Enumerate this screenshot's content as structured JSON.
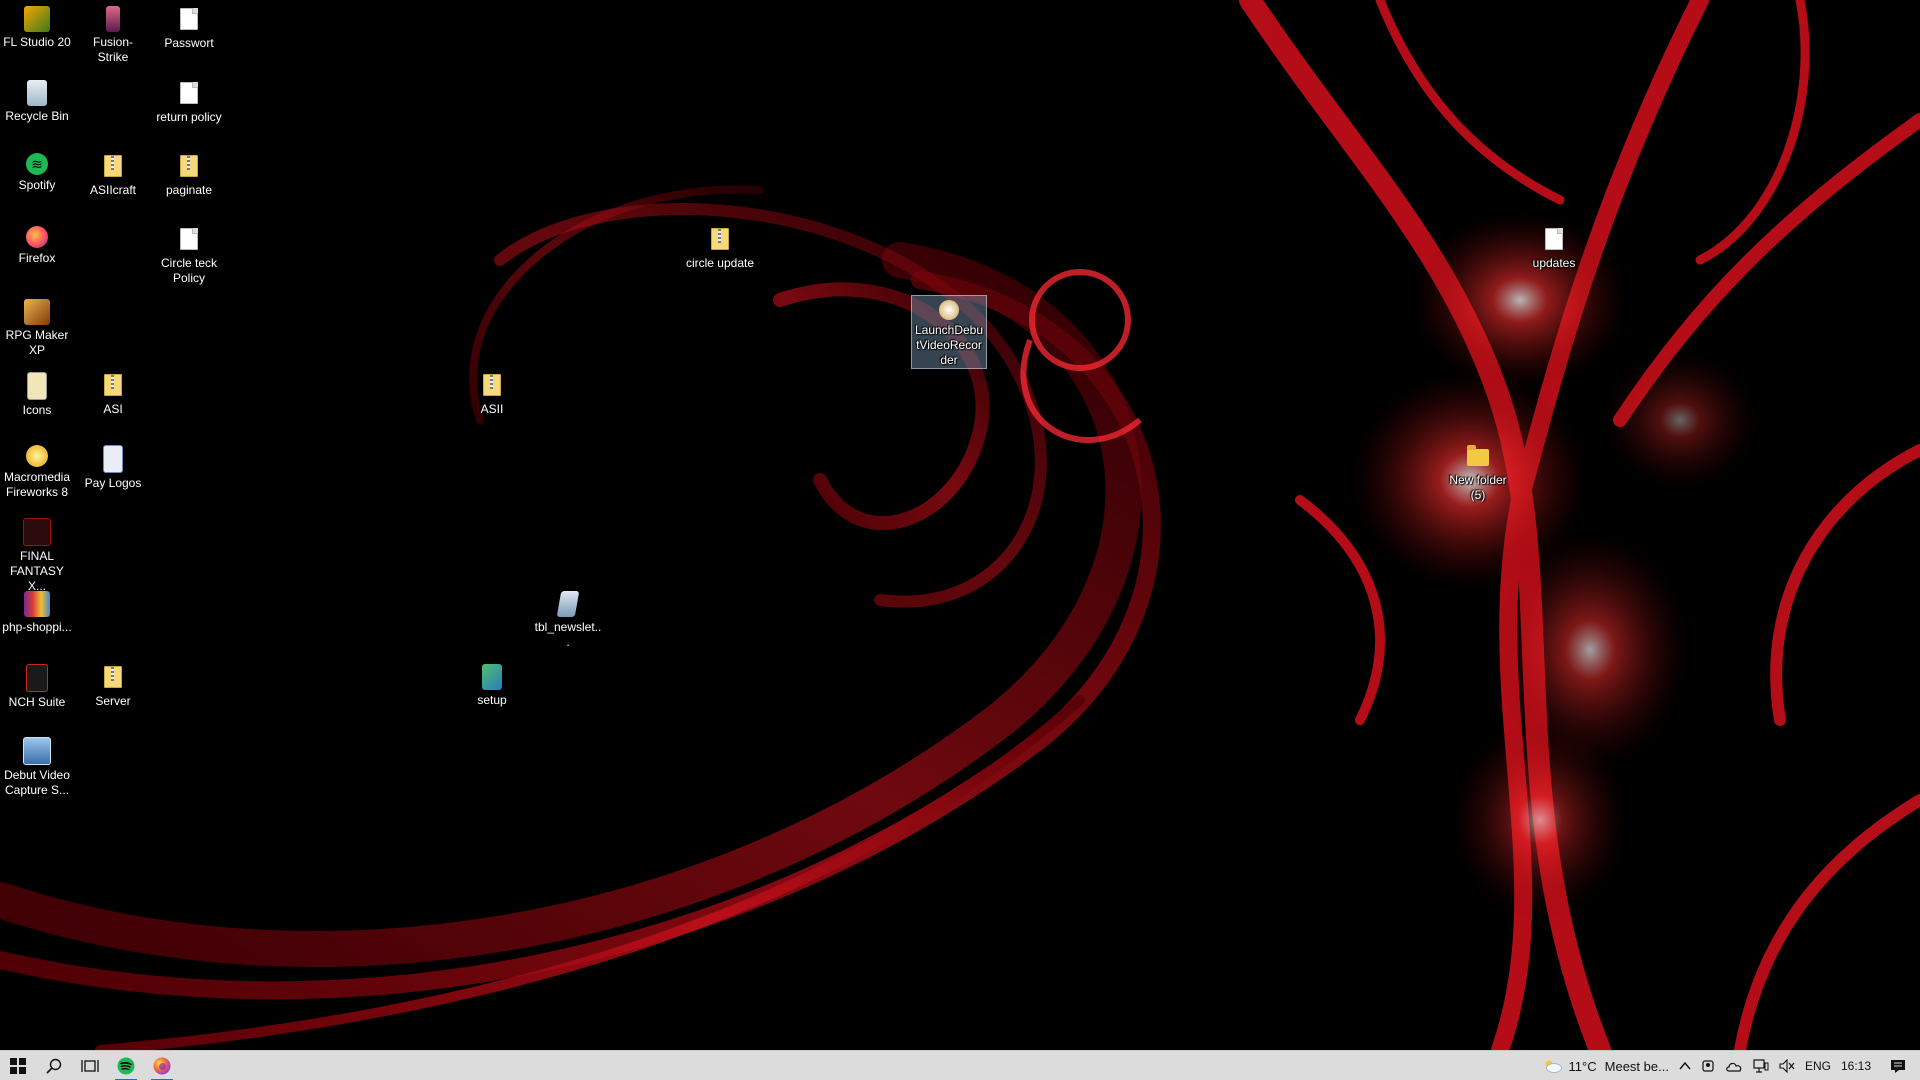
{
  "desktop": {
    "icons": [
      {
        "label": "FL Studio 20",
        "icon": "fl-studio-icon"
      },
      {
        "label": "Fusion-Strike",
        "icon": "fusion-strike-icon"
      },
      {
        "label": "Passwort",
        "icon": "document-icon"
      },
      {
        "label": "Recycle Bin",
        "icon": "recycle-bin-icon"
      },
      {
        "label": "return policy",
        "icon": "document-icon"
      },
      {
        "label": "Spotify",
        "icon": "spotify-icon"
      },
      {
        "label": "ASIIcraft",
        "icon": "zip-file-icon"
      },
      {
        "label": "paginate",
        "icon": "zip-file-icon"
      },
      {
        "label": "Firefox",
        "icon": "firefox-icon"
      },
      {
        "label": "Circle teck Policy",
        "icon": "document-icon"
      },
      {
        "label": "circle update",
        "icon": "zip-file-icon"
      },
      {
        "label": "updates",
        "icon": "document-icon"
      },
      {
        "label": "LaunchDebutVideoRecorder",
        "icon": "debut-launcher-icon"
      },
      {
        "label": "RPG Maker XP",
        "icon": "rpg-maker-icon"
      },
      {
        "label": "Icons",
        "icon": "icons-folder-icon"
      },
      {
        "label": "ASI",
        "icon": "zip-file-icon"
      },
      {
        "label": "ASII",
        "icon": "zip-file-icon"
      },
      {
        "label": "Macromedia Fireworks 8",
        "icon": "fireworks-icon"
      },
      {
        "label": "Pay Logos",
        "icon": "pay-logos-icon"
      },
      {
        "label": "New folder (5)",
        "icon": "folder-icon"
      },
      {
        "label": "FINAL FANTASY X...",
        "icon": "final-fantasy-icon"
      },
      {
        "label": "php-shoppi...",
        "icon": "winrar-icon"
      },
      {
        "label": "tbl_newslet...",
        "icon": "sql-file-icon"
      },
      {
        "label": "NCH Suite",
        "icon": "nch-suite-icon"
      },
      {
        "label": "Server",
        "icon": "zip-file-icon"
      },
      {
        "label": "setup",
        "icon": "setup-icon"
      },
      {
        "label": "Debut Video Capture S...",
        "icon": "debut-video-icon"
      }
    ],
    "selected_label": "LaunchDebutVideoRecorder"
  },
  "taskbar": {
    "pinned": [
      {
        "icon": "windows-start-icon"
      },
      {
        "icon": "search-icon"
      },
      {
        "icon": "task-view-icon"
      },
      {
        "icon": "spotify-icon"
      },
      {
        "icon": "firefox-icon"
      }
    ],
    "weather": {
      "temperature": "11°C",
      "text": "Meest be..."
    },
    "language": "ENG",
    "clock": "16:13"
  },
  "colors": {
    "taskbar_bg": "#dcdcdc",
    "accent": "#0078d7",
    "wallpaper_red": "#c8101c"
  }
}
